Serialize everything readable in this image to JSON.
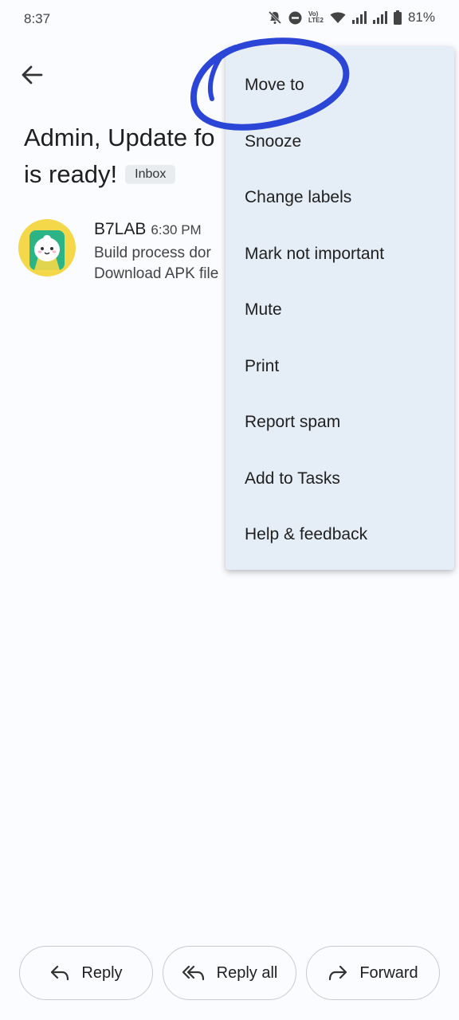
{
  "status_bar": {
    "time": "8:37",
    "battery": "81%",
    "network_label": "Vo) LTE2"
  },
  "email": {
    "subject_line1": "Admin, Update fo",
    "subject_line2": "is ready!",
    "label_chip": "Inbox",
    "sender": "B7LAB",
    "time": "6:30 PM",
    "preview_line1": "Build process dor",
    "preview_line2": "Download APK file"
  },
  "menu": {
    "items": [
      {
        "label": "Move to"
      },
      {
        "label": "Snooze"
      },
      {
        "label": "Change labels"
      },
      {
        "label": "Mark not important"
      },
      {
        "label": "Mute"
      },
      {
        "label": "Print"
      },
      {
        "label": "Report spam"
      },
      {
        "label": "Add to Tasks"
      },
      {
        "label": "Help & feedback"
      }
    ]
  },
  "actions": {
    "reply": "Reply",
    "reply_all": "Reply all",
    "forward": "Forward"
  },
  "colors": {
    "menu_bg": "#e5eef7",
    "annotation": "#2b45d6",
    "avatar_bg": "#f5d84a",
    "avatar_icon": "#2bb587"
  }
}
